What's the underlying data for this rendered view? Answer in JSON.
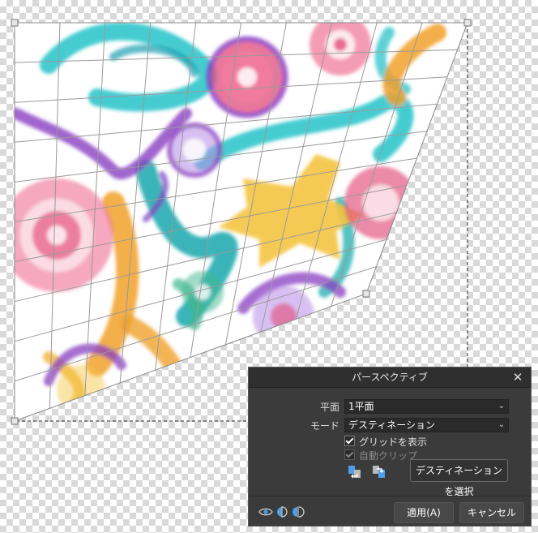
{
  "dialog": {
    "title": "パースペクティブ",
    "close_glyph": "✕",
    "plane_label": "平面",
    "plane_value": "1平面",
    "mode_label": "モード",
    "mode_value": "デスティネーション",
    "show_grid_label": "グリッドを表示",
    "show_grid_checked": true,
    "auto_clip_label": "自動クリップ",
    "auto_clip_checked": true,
    "auto_clip_disabled": true,
    "select_destination_label": "デスティネーションを選択",
    "apply_label": "適用(A)",
    "cancel_label": "キャンセル",
    "dropdown_icon": "chevron-down-icon",
    "footer_icons": [
      "eye-icon",
      "split-view-icon",
      "mirror-view-icon"
    ],
    "tool_icons": [
      "swap-source-icon",
      "swap-destination-icon"
    ]
  },
  "colors": {
    "panel_bg": "#3b3b3b",
    "title_bg": "#2f2f2f",
    "accent_blue": "#4f9ee8",
    "grid_line": "#9a9a9a",
    "handle_fill": "#e6e6e6"
  },
  "artwork": {
    "subject": "watercolor swirl pattern",
    "palette": [
      "#26c3c9",
      "#f0a12a",
      "#e24b7b",
      "#8a3fc2",
      "#f4c542",
      "#3fb88f"
    ]
  }
}
